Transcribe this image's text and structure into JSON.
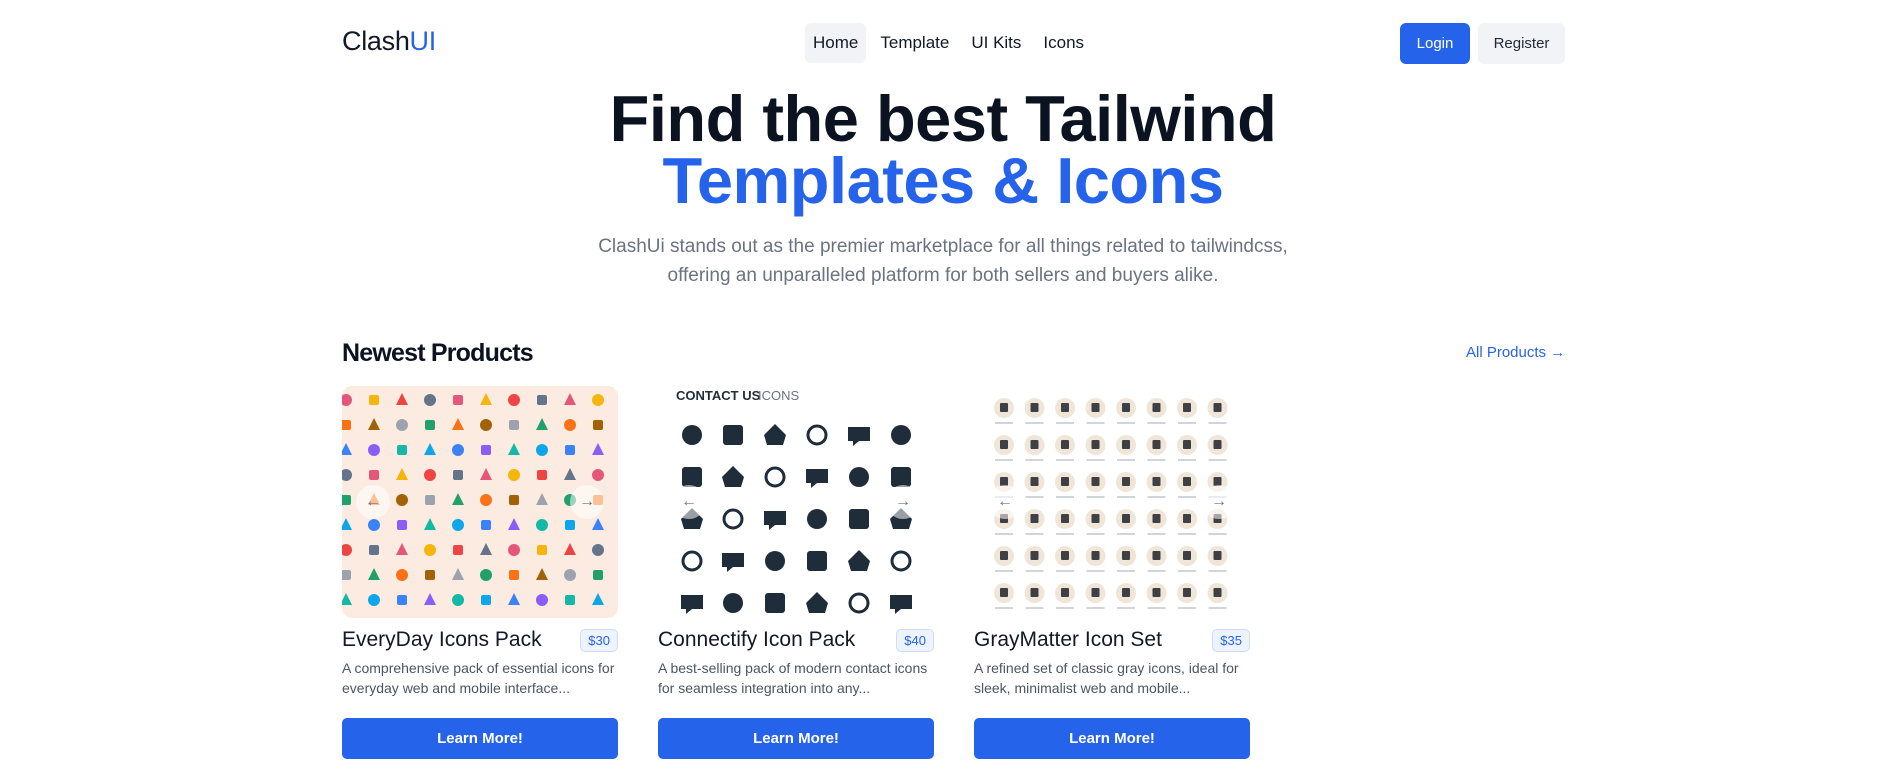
{
  "header": {
    "logo_main": "Clash",
    "logo_accent": "UI",
    "nav": [
      "Home",
      "Template",
      "UI Kits",
      "Icons"
    ],
    "login_label": "Login",
    "register_label": "Register"
  },
  "hero": {
    "title_line1": "Find the best Tailwind",
    "title_line2": "Templates & Icons",
    "subtitle": "ClashUi stands out as the premier marketplace for all things related to tailwindcss, offering an unparalleled platform for both sellers and buyers alike."
  },
  "section": {
    "title": "Newest Products",
    "all_link": "All Products →"
  },
  "products": [
    {
      "name": "EveryDay Icons Pack",
      "price": "$30",
      "description": "A comprehensive pack of essential icons for everyday web and mobile interface...",
      "button": "Learn More!"
    },
    {
      "name": "Connectify Icon Pack",
      "price": "$40",
      "description": "A best-selling pack of modern contact icons for seamless integration into any...",
      "button": "Learn More!",
      "thumb_heading_bold": "CONTACT US",
      "thumb_heading_light": "ICONS"
    },
    {
      "name": "GrayMatter Icon Set",
      "price": "$35",
      "description": "A refined set of classic gray icons, ideal for sleek, minimalist web and mobile...",
      "button": "Learn More!"
    }
  ],
  "carousel": {
    "prev_icon": "arrow-left-icon",
    "next_icon": "arrow-right-icon"
  },
  "colors": {
    "accent": "#2563eb",
    "thumb1_bg": "#fbebe0",
    "icon_dark": "#1f2d3a",
    "gray_circle": "#efe6d8"
  }
}
